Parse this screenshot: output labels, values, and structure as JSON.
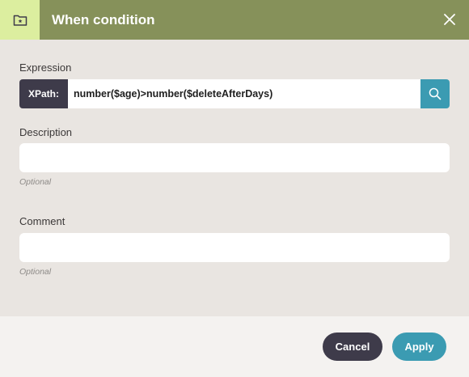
{
  "header": {
    "title": "When condition",
    "icon": "folder-star-icon",
    "close_icon": "close-icon"
  },
  "expression": {
    "label": "Expression",
    "prefix": "XPath:",
    "value": "number($age)>number($deleteAfterDays)",
    "search_icon": "search-icon"
  },
  "description": {
    "label": "Description",
    "value": "",
    "hint": "Optional"
  },
  "comment": {
    "label": "Comment",
    "value": "",
    "hint": "Optional"
  },
  "footer": {
    "cancel_label": "Cancel",
    "apply_label": "Apply"
  },
  "colors": {
    "header_bg": "#86915a",
    "header_icon_bg": "#dcee9f",
    "accent": "#3b9bb2",
    "dark": "#3e3b4a"
  }
}
